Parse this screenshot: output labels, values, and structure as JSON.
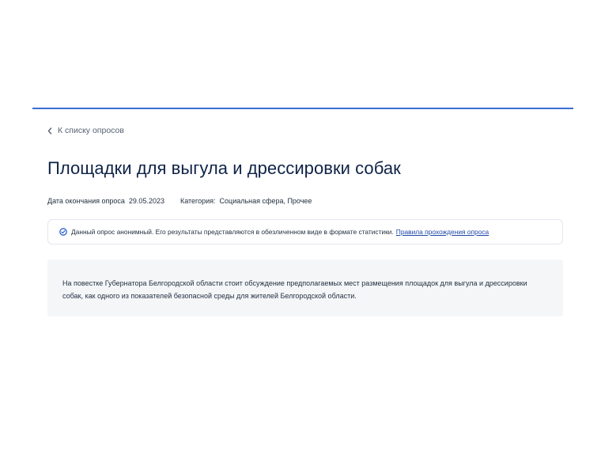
{
  "back_link": {
    "label": "К списку опросов",
    "icon": "chevron-left-icon"
  },
  "survey": {
    "title": "Площадки для выгула и дрессировки собак",
    "end_date_label": "Дата окончания опроса",
    "end_date": "29.05.2023",
    "category_label": "Категория:",
    "category": "Социальная сфера, Прочее"
  },
  "notice": {
    "icon": "anonymous-check-icon",
    "text": "Данный опрос анонимный. Его результаты представляются в обезличенном виде в формате статистики.",
    "rules_link": "Правила прохождения опроса"
  },
  "description": {
    "text": "На повестке Губернатора Белгородской области стоит обсуждение предполагаемых мест размещения площадок для выгула и дрессировки собак, как одного из показателей безопасной среды для жителей Белгородской области."
  },
  "colors": {
    "accent_rule": "#3b6fd4",
    "title": "#0f2347",
    "link": "#1f47a8",
    "panel_bg": "#f5f6f8"
  }
}
